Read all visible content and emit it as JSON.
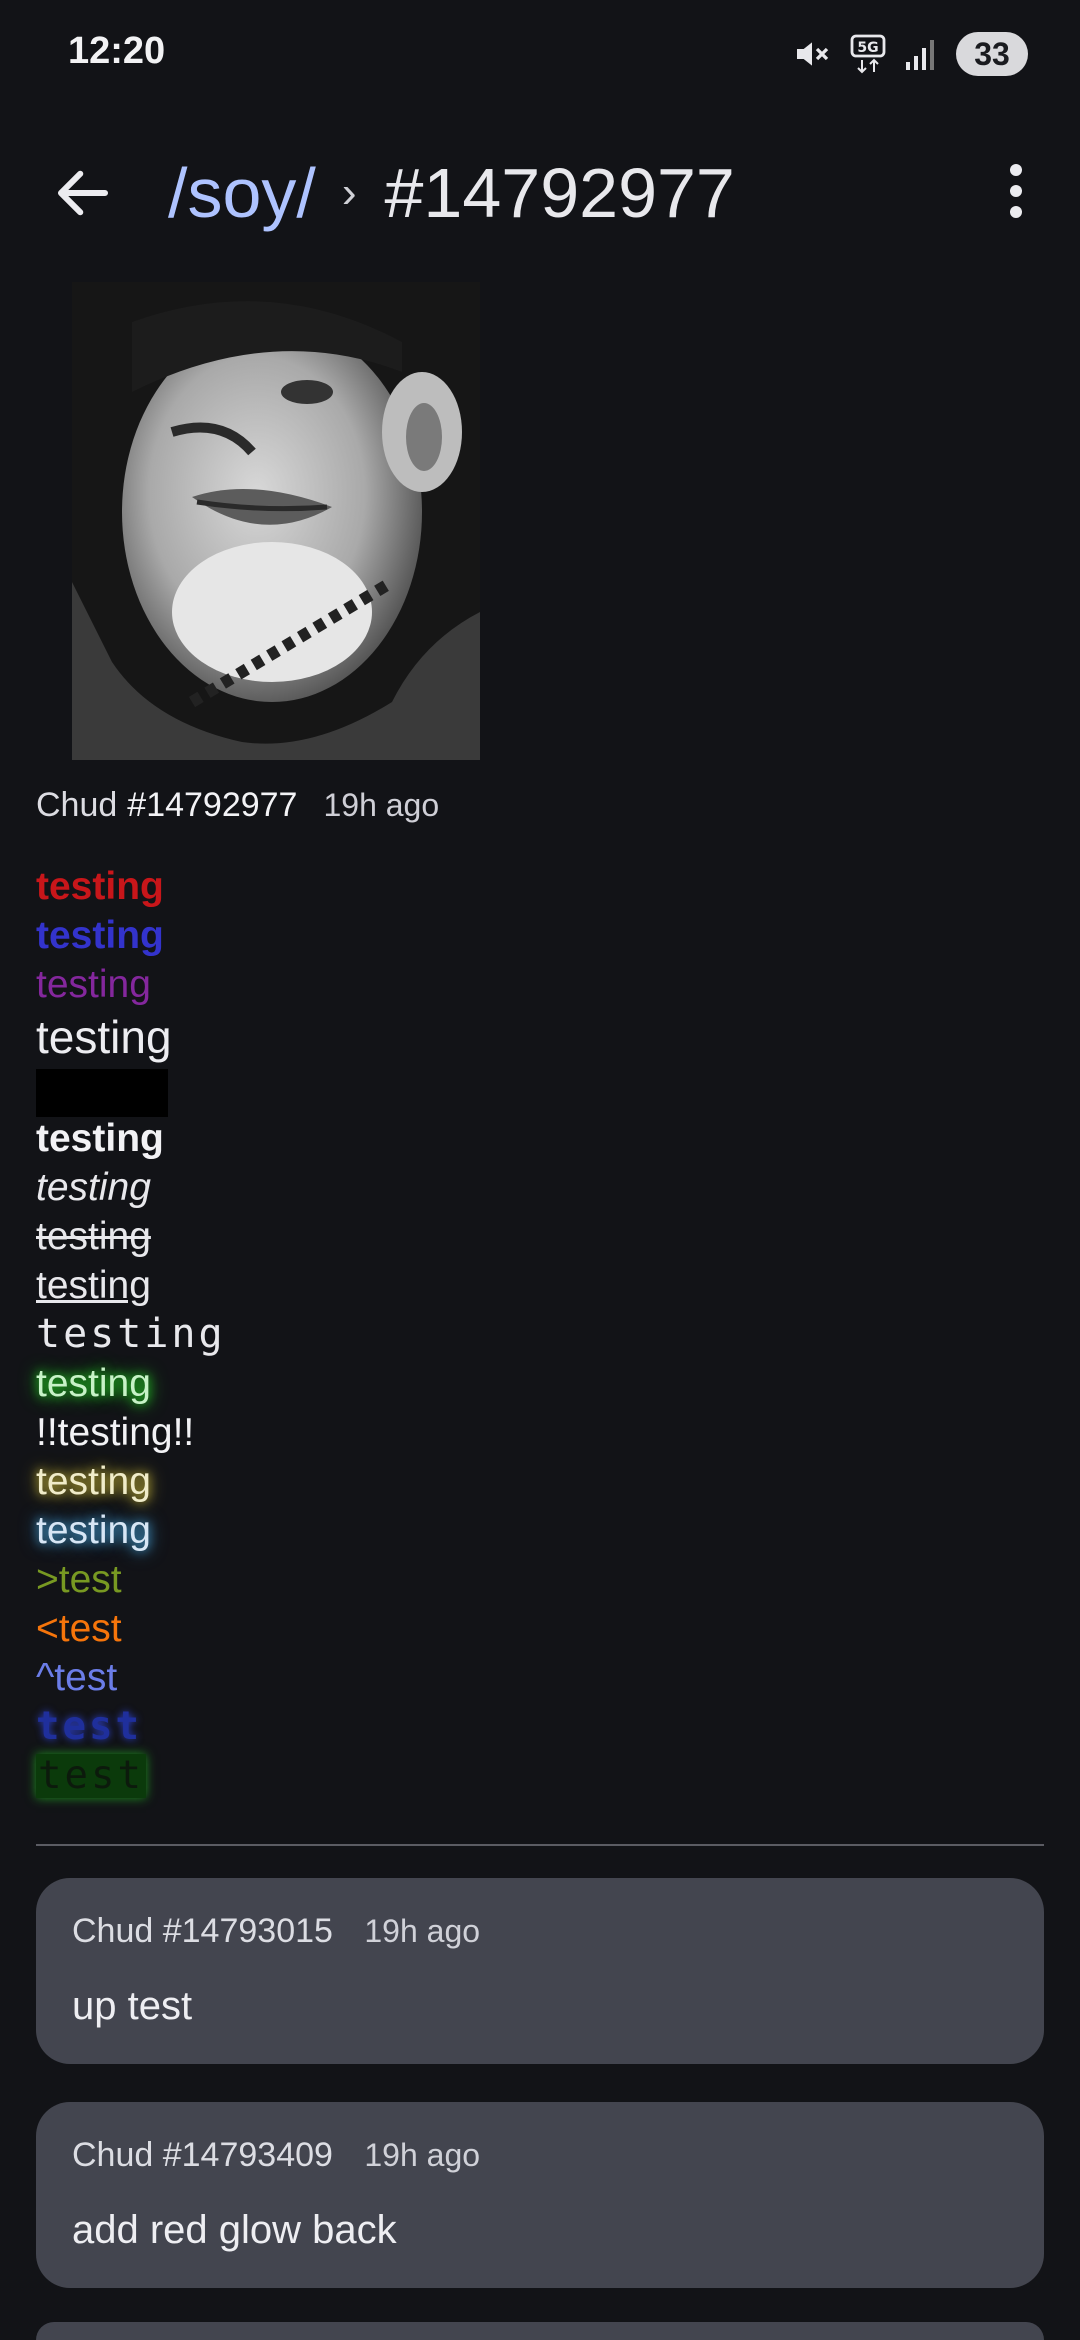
{
  "status_bar": {
    "time": "12:20",
    "battery": "33",
    "icons": [
      "mute-icon",
      "5g-icon",
      "signal-icon"
    ]
  },
  "app_bar": {
    "board": "/soy/",
    "separator": "›",
    "thread": "#14792977"
  },
  "op": {
    "author": "Chud",
    "number": "#14792977",
    "time_ago": "19h ago",
    "lines": [
      "testing",
      "testing",
      "testing",
      "testing",
      "",
      "testing",
      "testing",
      "testing",
      "testing",
      "testing",
      "testing",
      "!!testing!!",
      "testing",
      "testing",
      ">test",
      "<test",
      "^test",
      "test",
      "test"
    ]
  },
  "replies": [
    {
      "author": "Chud",
      "number": "#14793015",
      "time_ago": "19h ago",
      "text": "up test"
    },
    {
      "author": "Chud",
      "number": "#14793409",
      "time_ago": "19h ago",
      "text": "add red glow back"
    }
  ],
  "colors": {
    "background": "#121317",
    "board_link": "#aec3ff",
    "reply_card": "#43454f",
    "red_text": "#c8161a",
    "blue_text": "#3333cc",
    "purple_text": "#84279d",
    "greentext": "#789922",
    "orangetext": "#f6750b",
    "bluetext": "#6b7de8"
  }
}
